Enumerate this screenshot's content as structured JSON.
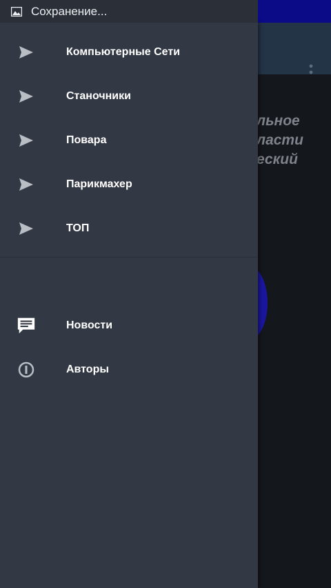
{
  "status_bar": {
    "text": "Сохранение..."
  },
  "background": {
    "lines": [
      "льное",
      "ласти",
      "еский"
    ]
  },
  "drawer": {
    "items": [
      {
        "label": "Компьютерные Сети",
        "icon": "send-icon"
      },
      {
        "label": "Станочники",
        "icon": "send-icon"
      },
      {
        "label": "Повара",
        "icon": "send-icon"
      },
      {
        "label": "Парикмахер",
        "icon": "send-icon"
      },
      {
        "label": "ТОП",
        "icon": "send-icon"
      }
    ],
    "secondary": [
      {
        "label": "Новости",
        "icon": "chat-icon"
      },
      {
        "label": "Авторы",
        "icon": "info-icon"
      }
    ]
  },
  "colors": {
    "drawer_bg": "#333944",
    "status_bar": "#0b0b88",
    "icon": "#b9bdc4"
  }
}
